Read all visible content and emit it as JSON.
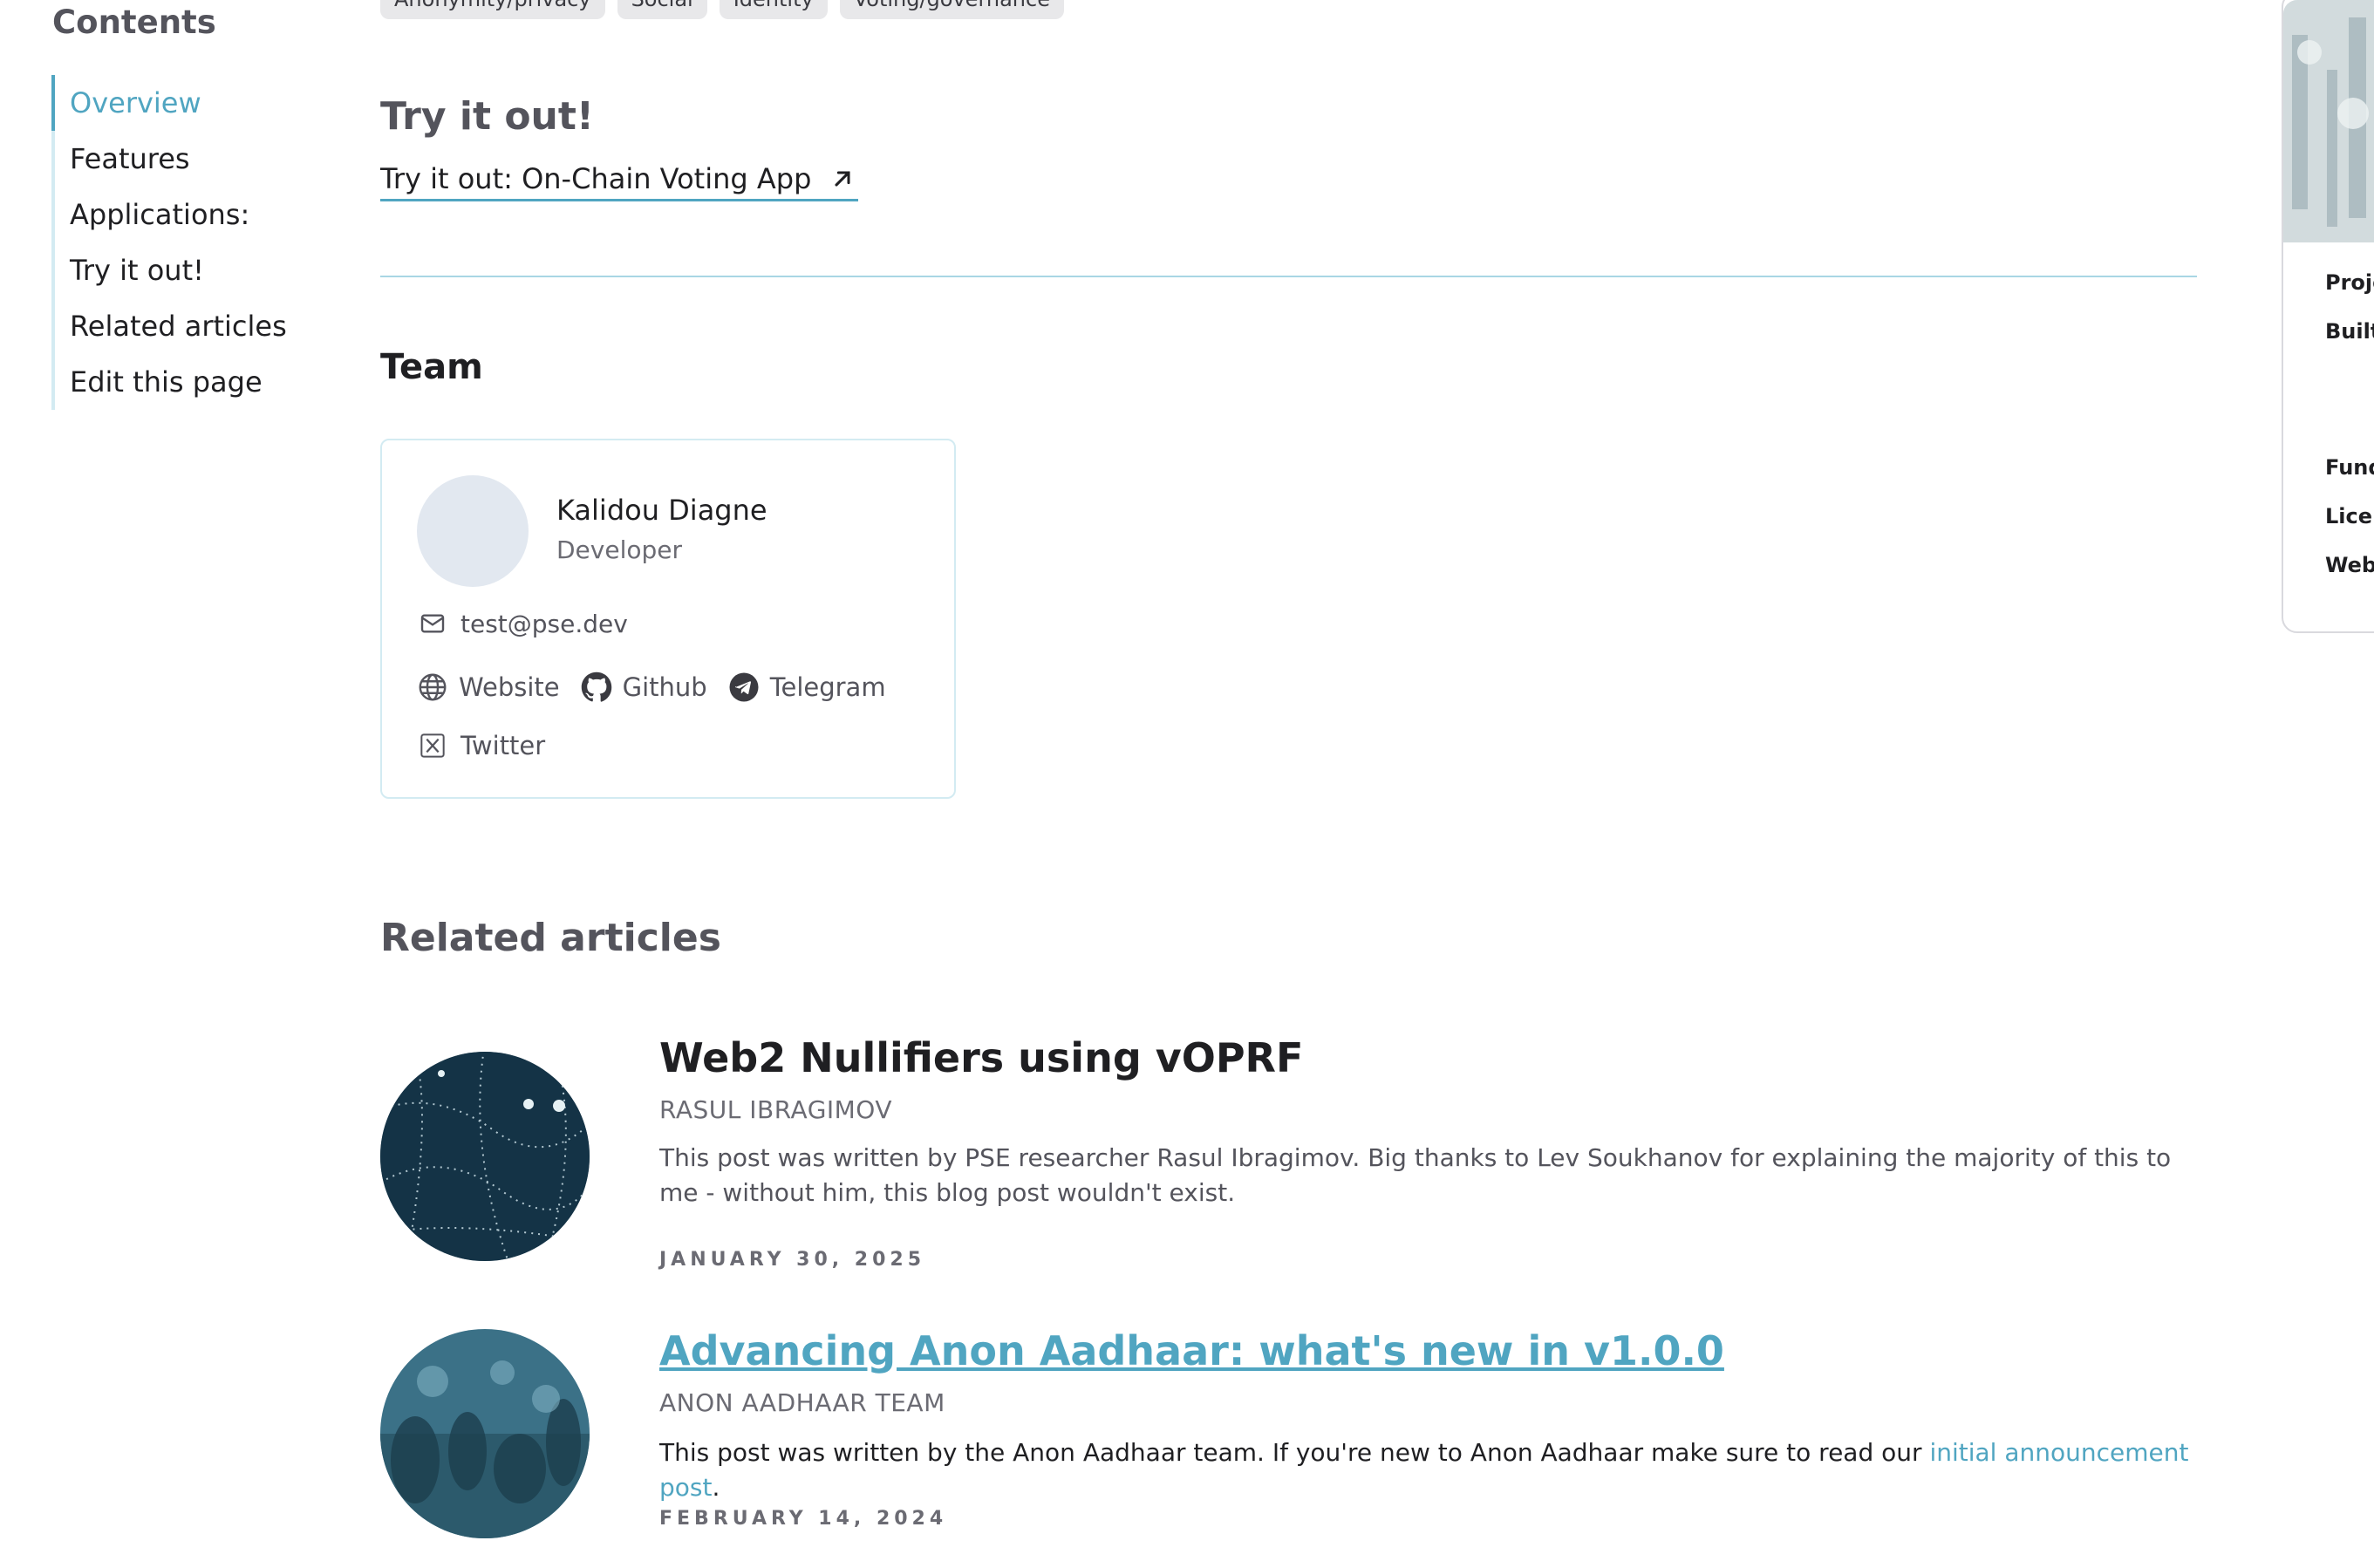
{
  "toc": {
    "title": "Contents",
    "items": [
      {
        "label": "Overview",
        "active": true
      },
      {
        "label": "Features"
      },
      {
        "label": "Applications:"
      },
      {
        "label": "Try it out!"
      },
      {
        "label": "Related articles"
      },
      {
        "label": "Edit this page"
      }
    ]
  },
  "tags": [
    "Anonymity/privacy",
    "Social",
    "Identity",
    "Voting/governance"
  ],
  "try_section": {
    "title": "Try it out!",
    "link_label": "Try it out: On-Chain Voting App"
  },
  "team": {
    "title": "Team",
    "member": {
      "name": "Kalidou Diagne",
      "role": "Developer",
      "email": "test@pse.dev",
      "links": {
        "website": "Website",
        "github": "Github",
        "telegram": "Telegram",
        "twitter": "Twitter"
      }
    }
  },
  "related": {
    "title": "Related articles",
    "articles": [
      {
        "title": "Web2 Nullifiers using vOPRF",
        "author": "RASUL IBRAGIMOV",
        "excerpt": "This post was written by PSE researcher Rasul Ibragimov. Big thanks to Lev Soukhanov for explaining the majority of this to me - without him, this blog post wouldn't exist.",
        "date": "JANUARY 30, 2025"
      },
      {
        "title": "Advancing Anon Aadhaar: what's new in v1.0.0",
        "author": "ANON AADHAAR TEAM",
        "excerpt_prefix": "This post was written by the Anon Aadhaar team. If you're new to Anon Aadhaar make sure to read our ",
        "excerpt_link": "initial announcement post",
        "excerpt_suffix": ".",
        "date": "FEBRUARY 14, 2024"
      }
    ]
  },
  "right_panel": {
    "labels": [
      "Proje",
      "Built",
      "Fund",
      "Licer",
      "Webs"
    ]
  },
  "colors": {
    "accent": "#50a5c1",
    "text": "#1f1f22",
    "muted": "#6b6b73"
  }
}
